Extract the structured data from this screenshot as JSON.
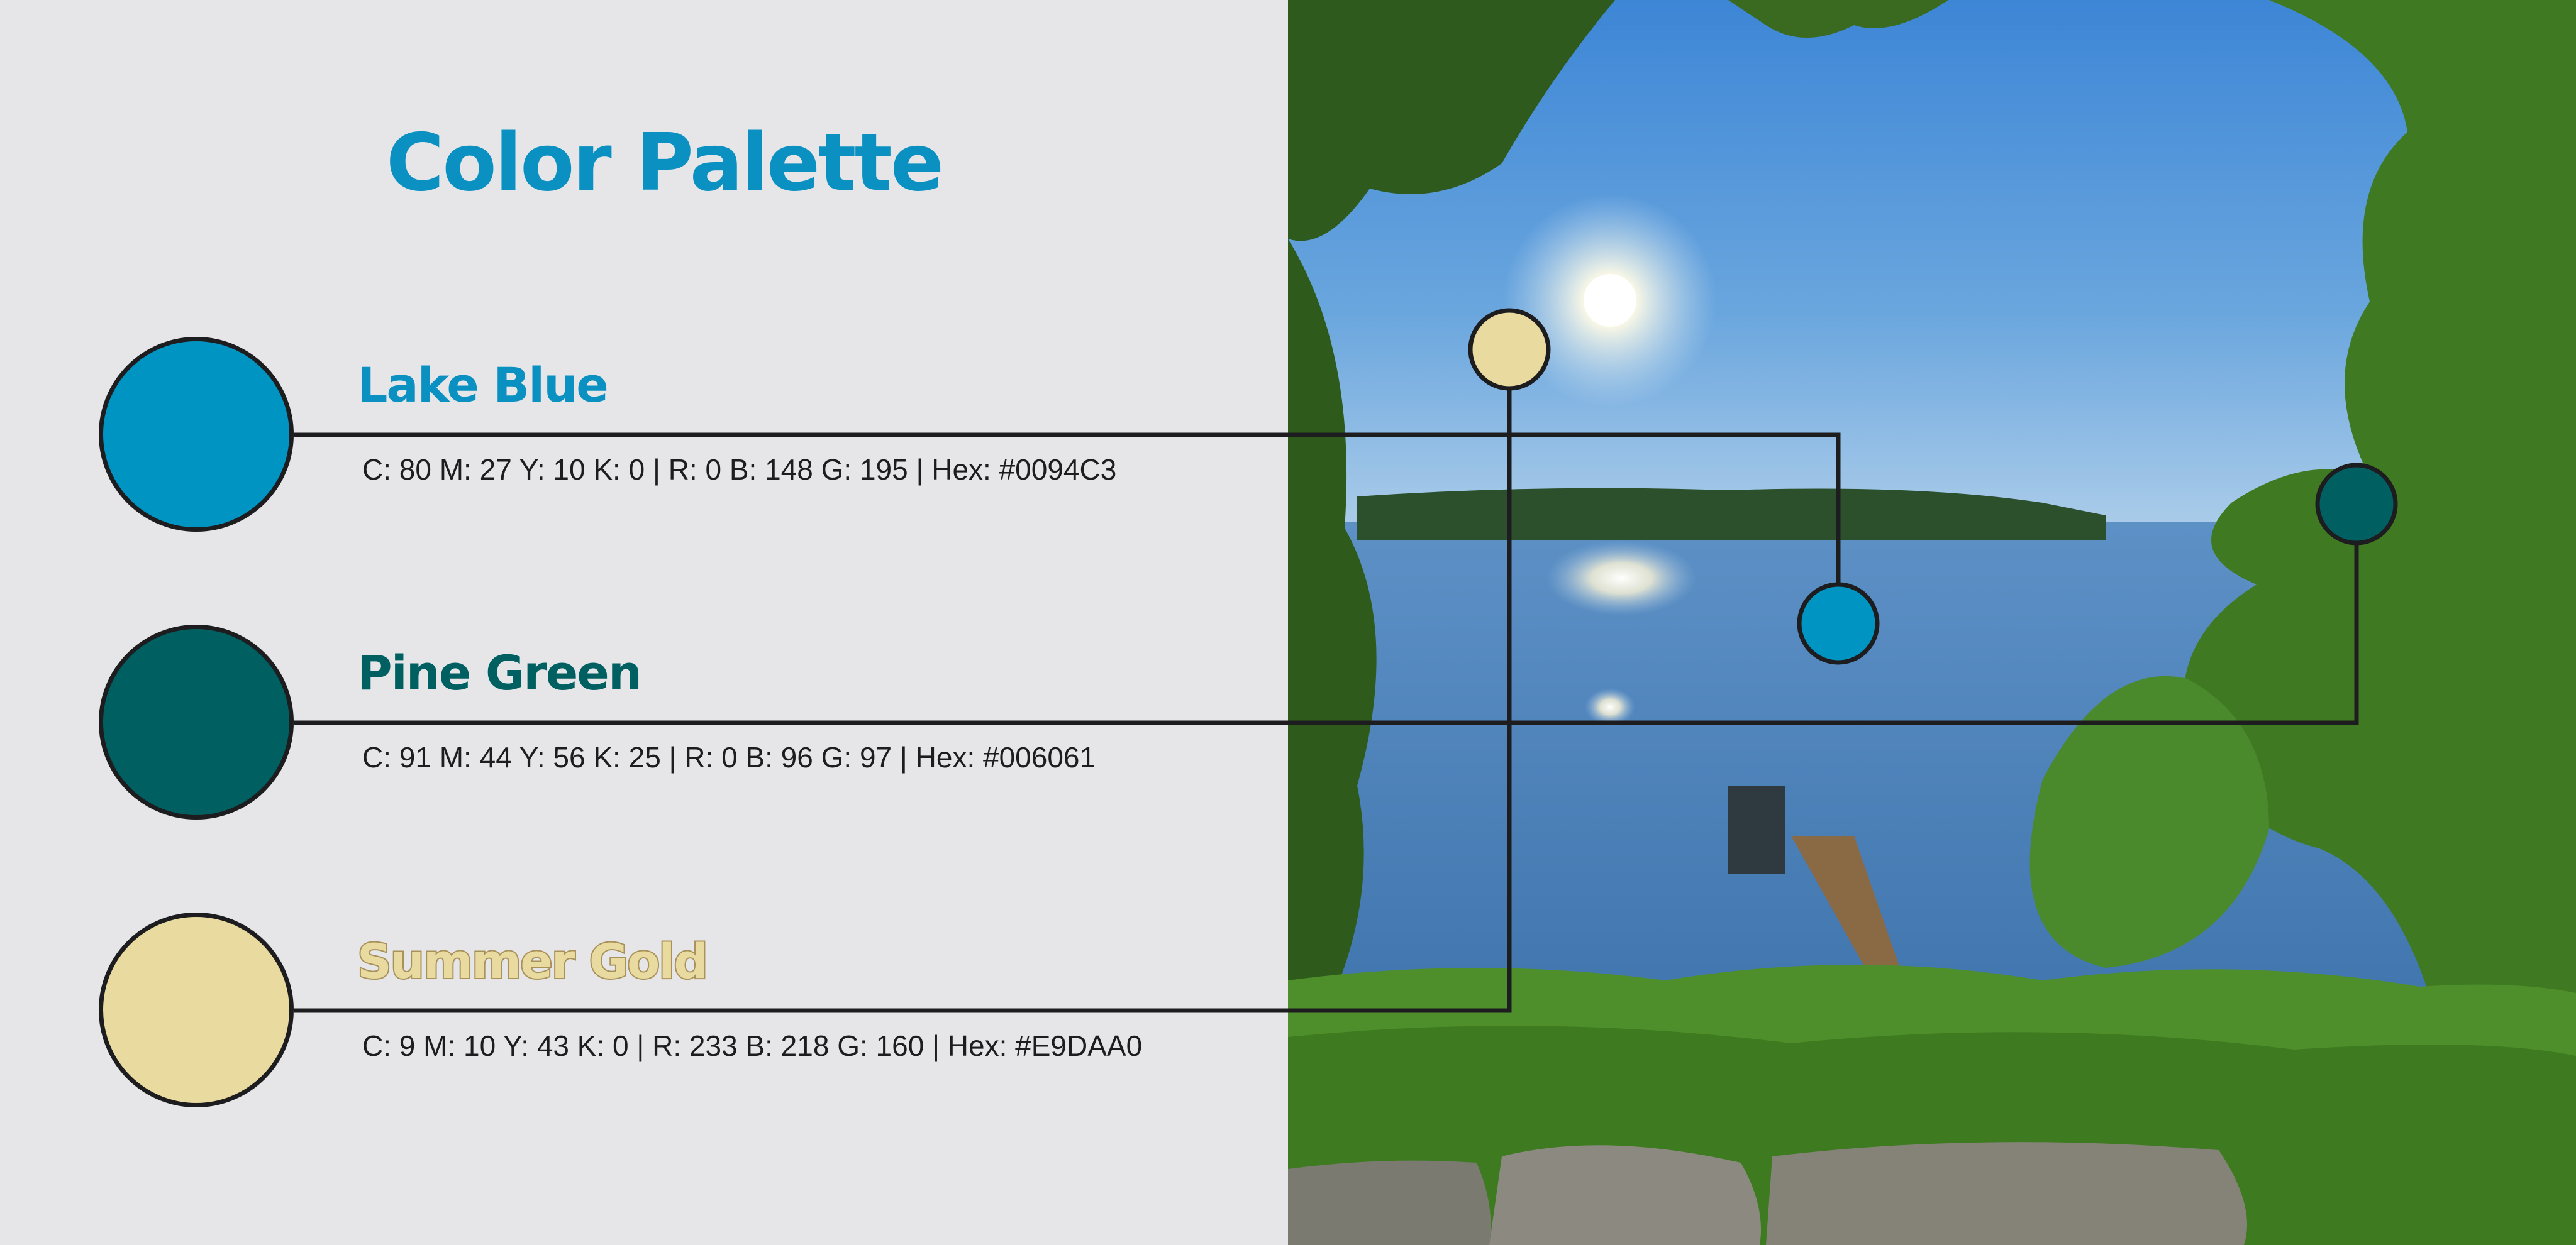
{
  "title": "Color Palette",
  "colors": [
    {
      "name": "Lake Blue",
      "spec": "C: 80  M: 27  Y: 10  K: 0   |   R: 0  B: 148  G: 195   |   Hex: #0094C3",
      "hex": "#0094C3"
    },
    {
      "name": "Pine Green",
      "spec": "C: 91  M: 44  Y: 56  K: 25   |   R: 0  B: 96  G: 97   |   Hex: #006061",
      "hex": "#006061"
    },
    {
      "name": "Summer Gold",
      "spec": "C: 9  M: 10  Y: 43  K: 0   |   R: 233  B: 218  G: 160   |   Hex: #E9DAA0",
      "hex": "#E9DAA0"
    }
  ],
  "theme": {
    "background": "#E6E6E9",
    "line": "#1D1D1F",
    "sky": "#5E9ED8",
    "water": "#4F86C1",
    "foliage": "#3C6E1F"
  }
}
